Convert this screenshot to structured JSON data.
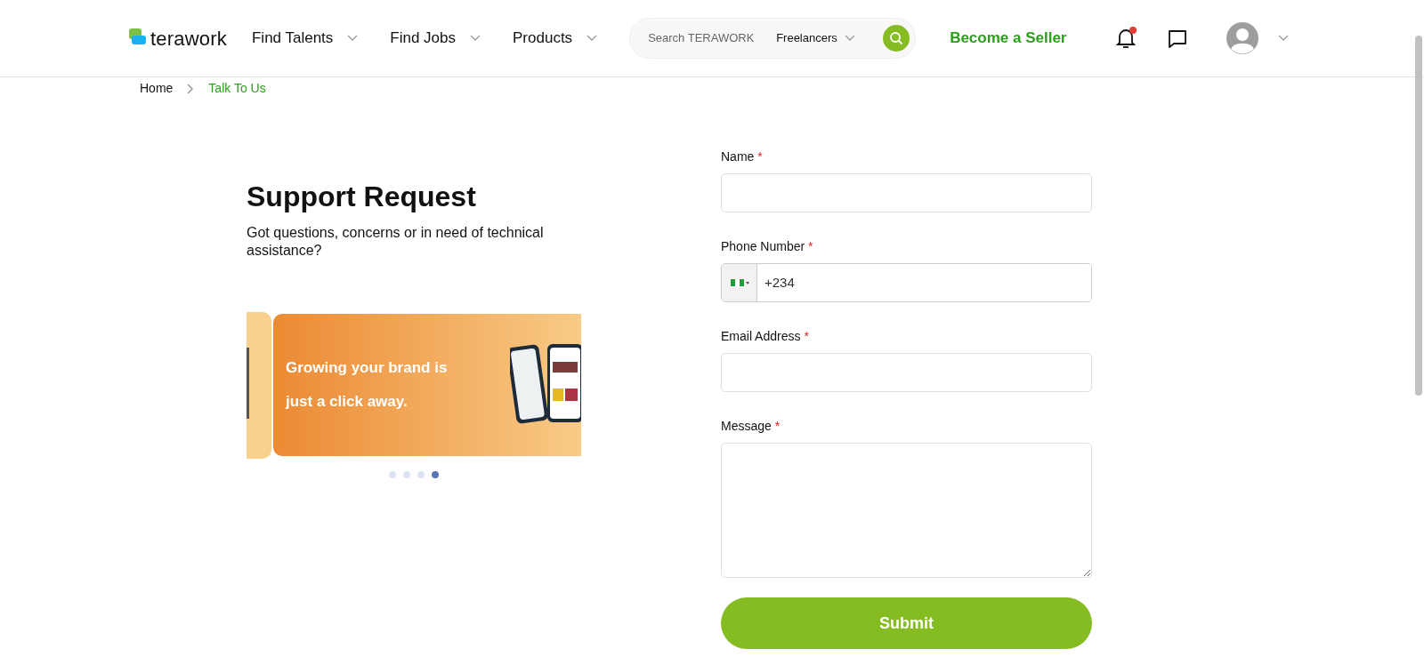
{
  "header": {
    "logo": "terawork",
    "nav": [
      {
        "label": "Find Talents"
      },
      {
        "label": "Find Jobs"
      },
      {
        "label": "Products"
      }
    ],
    "search": {
      "placeholder": "Search TERAWORK",
      "category": "Freelancers"
    },
    "cta": "Become a Seller",
    "notifications": {
      "unread": true
    }
  },
  "breadcrumb": [
    {
      "label": "Home",
      "selected": false
    },
    {
      "label": "Talk To Us",
      "selected": true
    }
  ],
  "intro": {
    "title": "Support Request",
    "text": "Got questions, concerns or in need of technical assistance?"
  },
  "carousel": {
    "slide_lines": [
      "Growing your brand is",
      "just a click away."
    ],
    "dots": [
      {
        "selected": false
      },
      {
        "selected": false
      },
      {
        "selected": false
      },
      {
        "selected": true
      }
    ]
  },
  "form": {
    "fields": [
      {
        "label": "Name",
        "required_mark": "*",
        "kind": "text"
      },
      {
        "label": "Phone Number",
        "required_mark": "*",
        "kind": "phone",
        "value": "+234"
      },
      {
        "label": "Email Address",
        "required_mark": "*",
        "kind": "text"
      },
      {
        "label": "Message",
        "required_mark": "*",
        "kind": "textarea"
      }
    ],
    "submit": "Submit"
  }
}
